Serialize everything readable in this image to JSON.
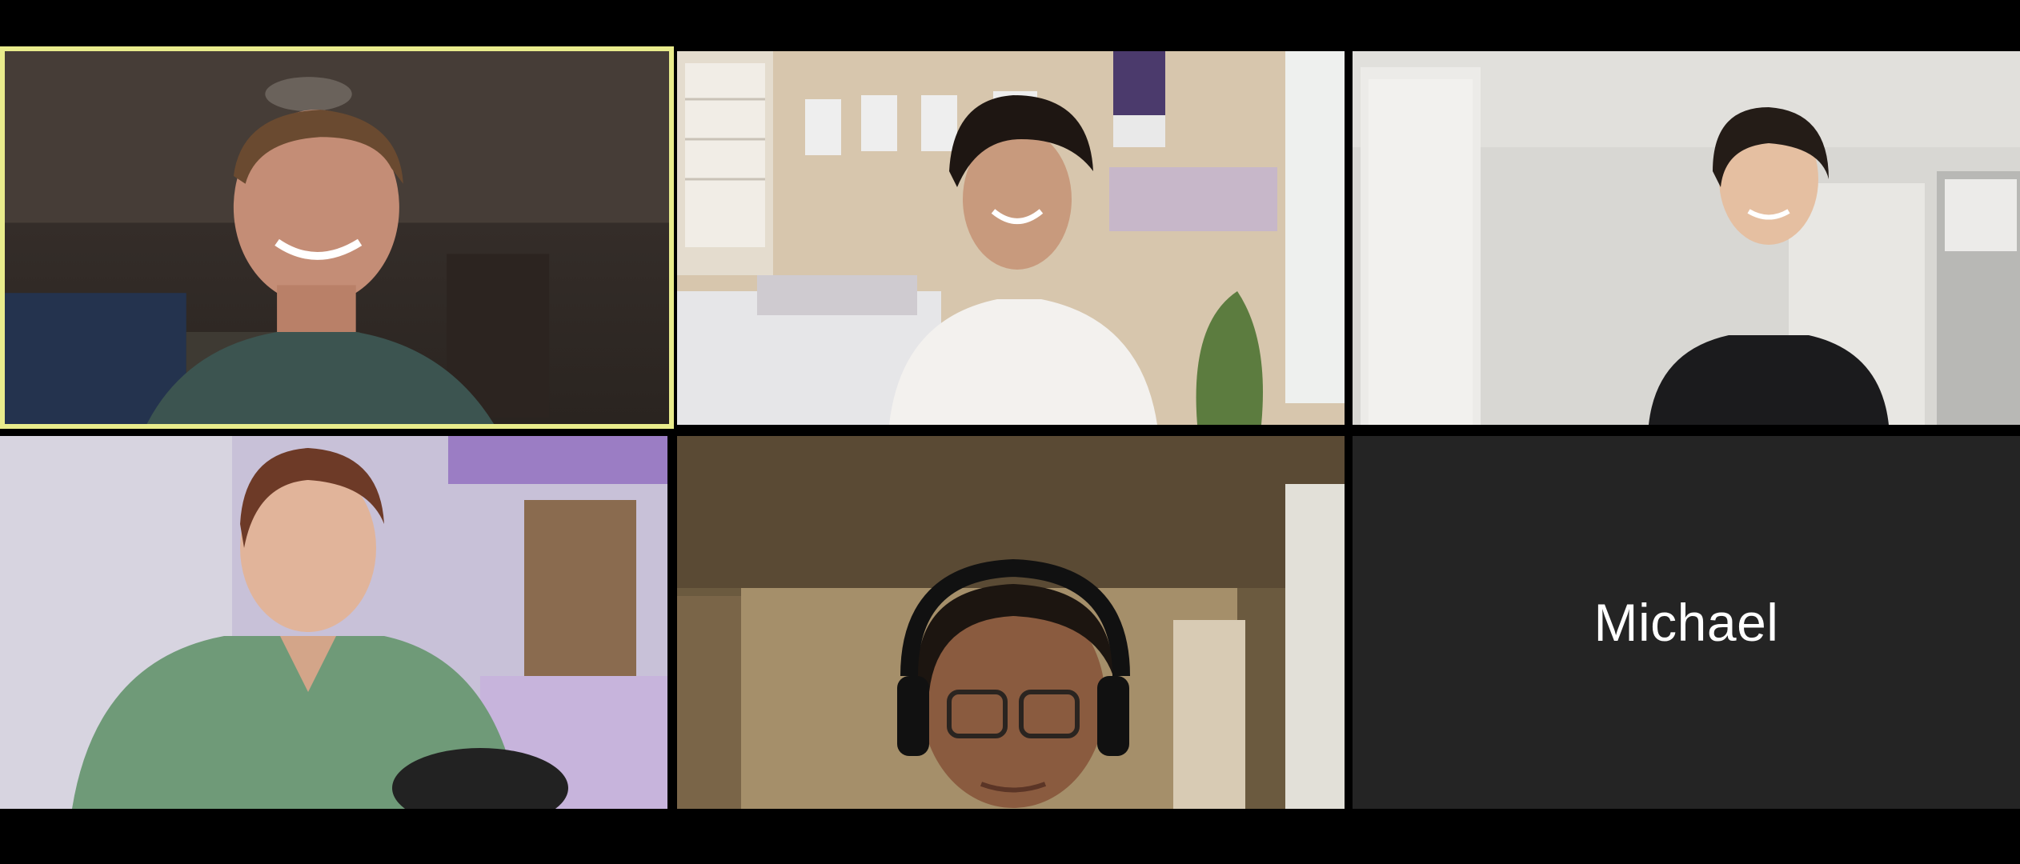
{
  "meeting": {
    "view": "gallery",
    "participant_count": 6
  },
  "participants": [
    {
      "video": true,
      "active_speaker": true,
      "accent": "#e9ec8c"
    },
    {
      "video": true,
      "active_speaker": false
    },
    {
      "video": true,
      "active_speaker": false
    },
    {
      "video": true,
      "active_speaker": false
    },
    {
      "video": true,
      "active_speaker": false
    },
    {
      "video": false,
      "active_speaker": false,
      "display_name": "Michael",
      "tile_color": "#242424"
    }
  ]
}
